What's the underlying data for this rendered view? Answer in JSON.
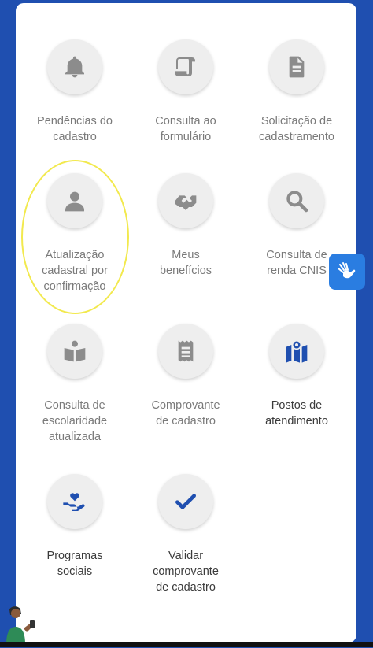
{
  "tiles": [
    {
      "label": "Pendências do\ncadastro",
      "icon": "bell-icon"
    },
    {
      "label": "Consulta ao\nformulário",
      "icon": "scroll-icon"
    },
    {
      "label": "Solicitação de\ncadastramento",
      "icon": "document-icon"
    },
    {
      "label": "Atualização\ncadastral por\nconfirmação",
      "icon": "person-icon"
    },
    {
      "label": "Meus\nbenefícios",
      "icon": "handshake-icon"
    },
    {
      "label": "Consulta de\nrenda CNIS",
      "icon": "search-icon"
    },
    {
      "label": "Consulta de\nescolaridade\natualizada",
      "icon": "book-reader-icon"
    },
    {
      "label": "Comprovante\nde cadastro",
      "icon": "receipt-icon"
    },
    {
      "label": "Postos de\natendimento",
      "icon": "map-location-icon"
    },
    {
      "label": "Programas\nsociais",
      "icon": "hand-heart-icon"
    },
    {
      "label": "Validar\ncomprovante\nde cadastro",
      "icon": "check-icon"
    }
  ],
  "accessibility_button": {
    "icon": "sign-language-hands-icon"
  },
  "colors": {
    "background": "#1f4fb0",
    "icon_gray": "#8c8c8c",
    "icon_blue": "#1f4fb0",
    "highlight": "#f2e94e",
    "a11y_button": "#2a7de1"
  }
}
